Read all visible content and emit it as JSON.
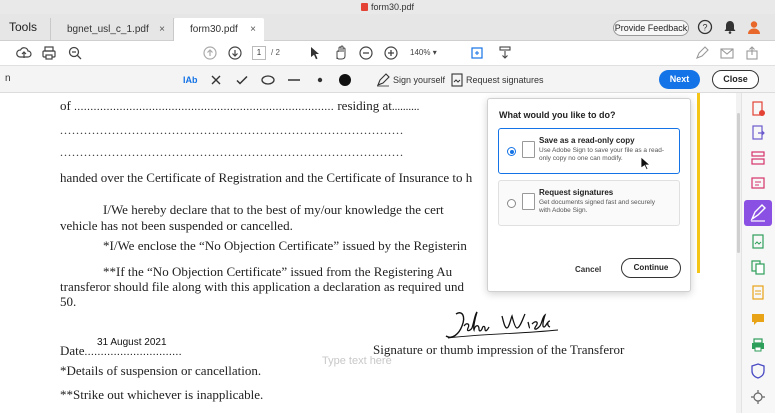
{
  "window": {
    "title": "form30.pdf"
  },
  "tabs": {
    "tools_label": "Tools",
    "items": [
      {
        "label": "bgnet_usl_c_1.pdf"
      },
      {
        "label": "form30.pdf"
      }
    ],
    "close_glyph": "×",
    "feedback_label": "Provide Feedback"
  },
  "toolbar": {
    "page_current": "1",
    "page_total": "/ 2",
    "zoom": "140%"
  },
  "signbar": {
    "text_tool_label": "Ab",
    "sign_yourself_label": "Sign yourself",
    "request_signatures_label": "Request signatures",
    "next_label": "Next",
    "close_label": "Close"
  },
  "document": {
    "line1_prefix": "of",
    "line1_dots": "................................................................................",
    "line1_suffix": "residing at",
    "line1_tail": "..........",
    "dots2": "......................................................................................",
    "dots3": "......................................................................................",
    "line4": "handed over the Certificate of Registration and the Certificate of Insurance to h",
    "line5": "I/We hereby declare that to the best of my/our knowledge the cert",
    "line6": "vehicle has not been suspended or cancelled.",
    "line7": "*I/We enclose the “No Objection Certificate” issued by the Registerin",
    "line8": "**If the “No Objection Certificate” issued from the Registering Au",
    "line9": "transferor should file along with this application a declaration as required und",
    "line10": "50.",
    "date_label": "Date",
    "date_dots": "..............................",
    "date_value": "31 August 2021",
    "placeholder": "Type text here",
    "signature_caption": "Signature or thumb impression of the Transferor",
    "foot1": "*Details of suspension or cancellation.",
    "foot2": "**Strike out whichever is inapplicable."
  },
  "popup": {
    "question": "What would you like to do?",
    "options": [
      {
        "title": "Save as a read-only copy",
        "desc": "Use Adobe Sign to save your file as a read-only copy no one can modify.",
        "selected": true
      },
      {
        "title": "Request signatures",
        "desc": "Get documents signed fast and securely with Adobe Sign.",
        "selected": false
      }
    ],
    "cancel_label": "Cancel",
    "continue_label": "Continue"
  },
  "colors": {
    "accent": "#1473e6",
    "active_tool": "#8a4fe3",
    "pdf_red": "#e34234"
  }
}
